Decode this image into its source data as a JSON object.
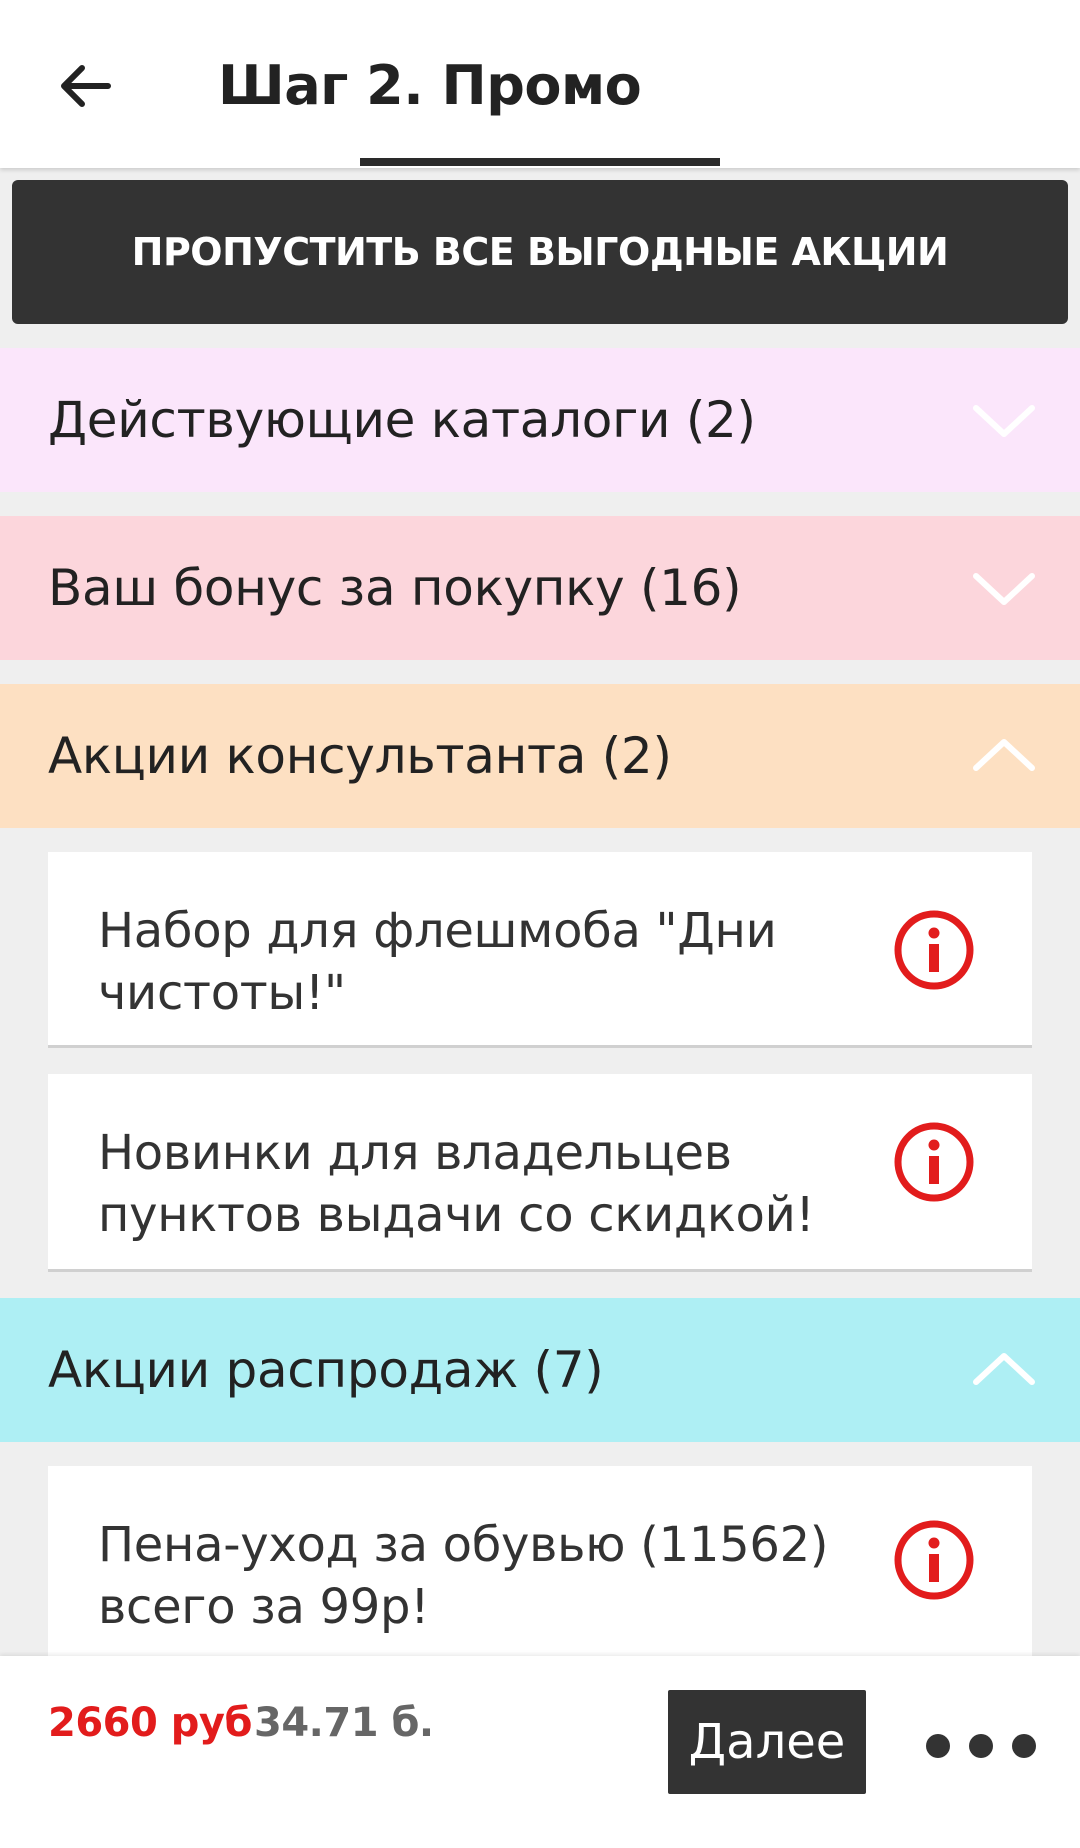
{
  "appbar": {
    "title": "Шаг 2. Промо",
    "back_icon": "arrow-left-icon"
  },
  "skip_button": {
    "label": "ПРОПУСТИТЬ ВСЕ ВЫГОДНЫЕ АКЦИИ"
  },
  "sections": [
    {
      "label": "Действующие каталоги (2)",
      "color": "#fbe6fb",
      "expanded": false
    },
    {
      "label": "Ваш бонус за покупку (16)",
      "color": "#fcd6dc",
      "expanded": false
    },
    {
      "label": "Акции консультанта (2)",
      "color": "#fde0c2",
      "expanded": true
    },
    {
      "label": "Акции распродаж (7)",
      "color": "#aeeff4",
      "expanded": true
    }
  ],
  "consultant_items": [
    {
      "text": "Набор для флешмоба \"Дни чистоты!\""
    },
    {
      "text": "Новинки для владельцев пунктов выдачи  со скидкой!"
    }
  ],
  "sale_items": [
    {
      "text": "Пена-уход за обувью (11562) всего за 99р!"
    }
  ],
  "footer": {
    "price": "2660 руб",
    "points": "34.71 б.",
    "next_label": "Далее",
    "more_icon": "more-horizontal-icon"
  },
  "colors": {
    "accent_red": "#e21c1c",
    "dark": "#333333"
  }
}
